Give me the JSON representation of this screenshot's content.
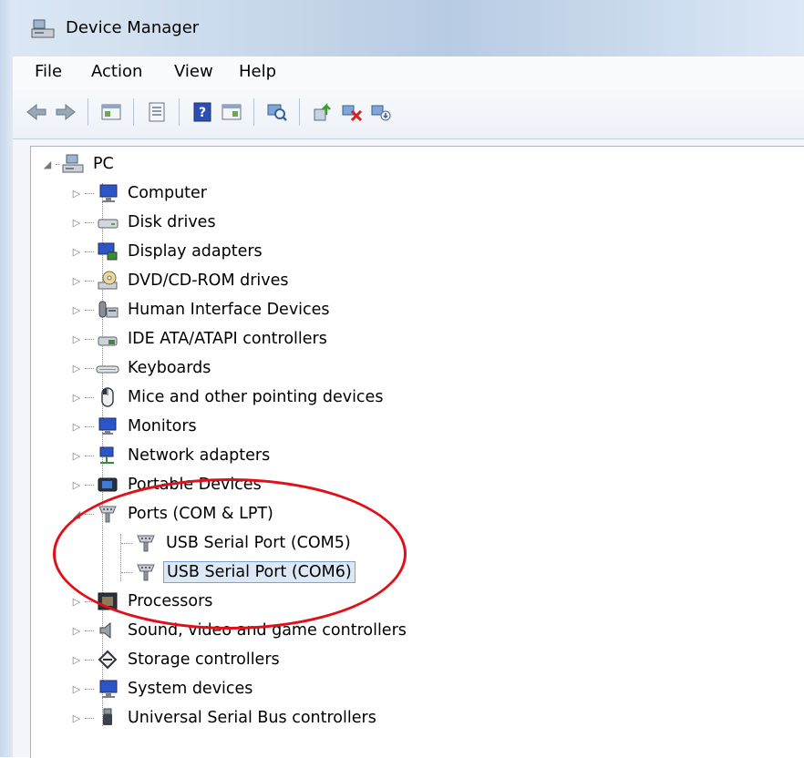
{
  "window": {
    "title": "Device Manager"
  },
  "menu": {
    "items": [
      "File",
      "Action",
      "View",
      "Help"
    ]
  },
  "toolbar": {
    "buttons": [
      "back-icon",
      "forward-icon",
      "properties-icon",
      "print-icon",
      "help-icon",
      "view-icon",
      "scan-icon",
      "update-driver-icon",
      "disable-device-icon",
      "uninstall-device-icon"
    ]
  },
  "tree": {
    "root": "PC",
    "categories": [
      "Computer",
      "Disk drives",
      "Display adapters",
      "DVD/CD-ROM drives",
      "Human Interface Devices",
      "IDE ATA/ATAPI controllers",
      "Keyboards",
      "Mice and other pointing devices",
      "Monitors",
      "Network adapters",
      "Portable Devices",
      "Ports (COM & LPT)",
      "Processors",
      "Sound, video and game controllers",
      "Storage controllers",
      "System devices",
      "Universal Serial Bus controllers"
    ],
    "ports_children": [
      "USB Serial Port (COM5)",
      "USB Serial Port (COM6)"
    ],
    "selected": "USB Serial Port (COM6)"
  },
  "colors": {
    "annotation_circle": "#e0101a",
    "selection": "#dde8f6"
  }
}
